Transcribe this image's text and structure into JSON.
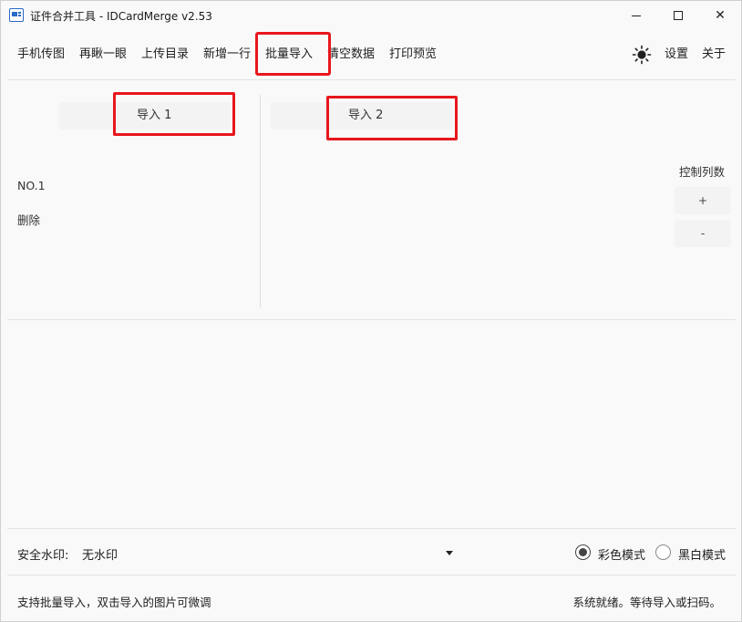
{
  "window": {
    "title": "证件合并工具 - IDCardMerge v2.53",
    "minimize_icon": "minimize-icon",
    "maximize_icon": "maximize-icon",
    "close_symbol": "✕"
  },
  "toolbar": {
    "items": [
      {
        "id": "phone",
        "label": "手机传图"
      },
      {
        "id": "scan",
        "label": "再瞅一眼"
      },
      {
        "id": "upload",
        "label": "上传目录"
      },
      {
        "id": "addrow",
        "label": "新增一行"
      },
      {
        "id": "batch",
        "label": "批量导入"
      },
      {
        "id": "clear",
        "label": "清空数据"
      },
      {
        "id": "print",
        "label": "打印预览"
      }
    ],
    "theme_icon": "sun-icon",
    "settings_label": "设置",
    "about_label": "关于"
  },
  "grid": {
    "col1_header": "导入 1",
    "col2_header": "导入 2",
    "row_label": "NO.1",
    "delete_label": "删除",
    "control_columns_label": "控制列数",
    "add_col_label": "+",
    "remove_col_label": "-"
  },
  "watermark": {
    "label": "安全水印:",
    "selected": "无水印"
  },
  "mode": {
    "color_label": "彩色模式",
    "bw_label": "黑白模式",
    "selected": "color"
  },
  "status": {
    "hint": "支持批量导入，双击导入的图片可微调",
    "state": "系统就绪。等待导入或扫码。"
  },
  "colors": {
    "highlight": "#e8161c",
    "icon_blue": "#2a6ac8"
  }
}
